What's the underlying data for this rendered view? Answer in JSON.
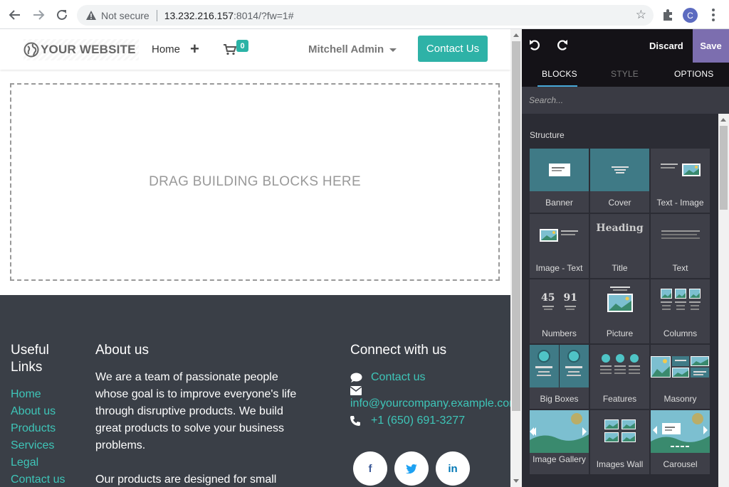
{
  "browser": {
    "security_label": "Not secure",
    "url_host": "13.232.216.157",
    "url_path": ":8014/?fw=1#",
    "profile_initial": "C"
  },
  "site": {
    "logo_text": "YOUR WEBSITE",
    "nav_home": "Home",
    "cart_count": "0",
    "user_name": "Mitchell Admin",
    "contact_button": "Contact Us",
    "dropzone_text": "DRAG BUILDING BLOCKS HERE",
    "footer": {
      "links_title": "Useful Links",
      "links": [
        "Home",
        "About us",
        "Products",
        "Services",
        "Legal",
        "Contact us"
      ],
      "about_title": "About us",
      "about_p1": "We are a team of passionate people whose goal is to improve everyone's life through disruptive products. We build great products to solve your business problems.",
      "about_p2": "Our products are designed for small",
      "connect_title": "Connect with us",
      "contact_link": "Contact us",
      "email": "info@yourcompany.example.com",
      "phone": "+1 (650) 691-3277",
      "social": [
        "f",
        "t",
        "in"
      ]
    }
  },
  "editor": {
    "discard": "Discard",
    "save": "Save",
    "tabs": [
      "BLOCKS",
      "STYLE",
      "OPTIONS"
    ],
    "search_placeholder": "Search...",
    "section_title": "Structure",
    "blocks": [
      "Banner",
      "Cover",
      "Text - Image",
      "Image - Text",
      "Title",
      "Text",
      "Numbers",
      "Picture",
      "Columns",
      "Big Boxes",
      "Features",
      "Masonry",
      "Image Gallery",
      "Images Wall",
      "Carousel"
    ],
    "thumb_heading": "Heading",
    "thumb_numbers": [
      "45",
      "91"
    ]
  },
  "colors": {
    "accent_teal": "#2eb2a7",
    "link_teal": "#3ec5b8",
    "footer_bg": "#3a3f47",
    "panel_bg": "#2b2c34",
    "save_purple": "#7c6eaf"
  }
}
